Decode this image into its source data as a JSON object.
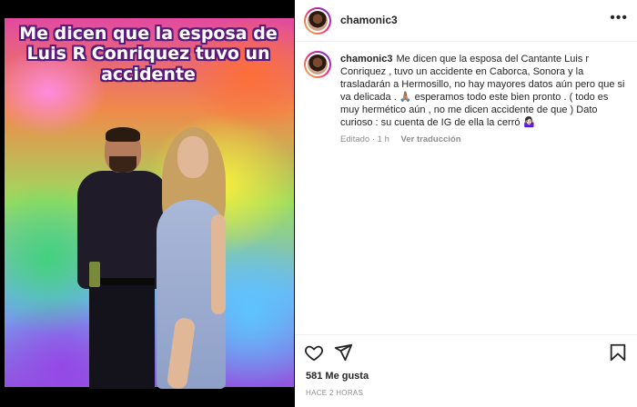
{
  "post": {
    "image_overlay_text": "Me dicen que la esposa de Luis R Conriquez tuvo un accidente",
    "username": "chamonic3",
    "more_label": "•••",
    "caption": "Me dicen que la esposa del Cantante Luis r Conriquez , tuvo un accidente en Caborca, Sonora y la trasladarán a Hermosillo, no hay mayores datos aún pero que si va delicada . 🙏🏽 esperamos todo este bien pronto . ( todo es muy hermético aún , no me dicen accidente de que ) Dato curioso : su cuenta de IG de ella la cerró 🤷🏻‍♀️",
    "edited_time": "Editado · 1 h",
    "see_translation": "Ver traducción",
    "likes": "581 Me gusta",
    "posted_ago": "HACE 2 HORAS"
  },
  "icons": {
    "like": "heart-icon",
    "share": "paper-plane-icon",
    "save": "bookmark-icon",
    "more": "more-options-icon"
  },
  "colors": {
    "text_primary": "#262626",
    "text_secondary": "#8e8e8e",
    "divider": "#efefef",
    "overlay_outline": "#5a1a7a"
  }
}
